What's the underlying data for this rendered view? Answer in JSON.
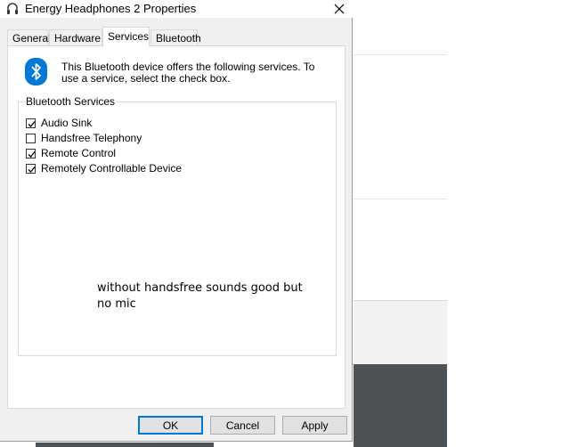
{
  "dialog": {
    "title": "Energy Headphones 2 Properties",
    "tabs": [
      {
        "label": "General"
      },
      {
        "label": "Hardware"
      },
      {
        "label": "Services"
      },
      {
        "label": "Bluetooth"
      }
    ],
    "active_tab": "Services",
    "description": "This Bluetooth device offers the following services. To use a service, select the check box.",
    "group_label": "Bluetooth Services",
    "services": [
      {
        "label": "Audio Sink",
        "checked": true
      },
      {
        "label": "Handsfree Telephony",
        "checked": false
      },
      {
        "label": "Remote Control",
        "checked": true
      },
      {
        "label": "Remotely Controllable Device",
        "checked": true
      }
    ],
    "note": "without handsfree sounds good but no mic",
    "buttons": {
      "ok": "OK",
      "cancel": "Cancel",
      "apply": "Apply"
    }
  },
  "colors": {
    "bluetooth_blue": "#0078d7",
    "dialog_bg": "#f0f0f0",
    "panel_bg": "#ffffff",
    "background_dark": "#4d5256"
  },
  "icons": {
    "title": "headphones-icon",
    "close": "close-icon",
    "logo": "bluetooth-icon",
    "checkbox": "checkmark-icon"
  }
}
